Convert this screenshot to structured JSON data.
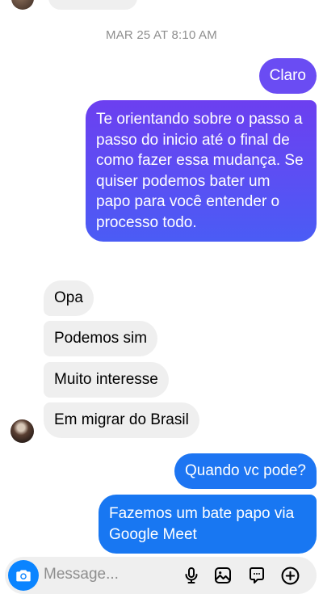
{
  "thread": {
    "date_separator": "MAR 25 AT 8:10 AM",
    "messages": [
      {
        "id": "m1",
        "direction": "outgoing",
        "text": "Claro"
      },
      {
        "id": "m2",
        "direction": "outgoing",
        "text": "Te orientando sobre o passo a passo do inicio até o final de como fazer essa mudança. Se quiser podemos bater um papo para você entender o processo todo."
      },
      {
        "id": "m3",
        "direction": "incoming",
        "text": "Opa"
      },
      {
        "id": "m4",
        "direction": "incoming",
        "text": "Podemos sim"
      },
      {
        "id": "m5",
        "direction": "incoming",
        "text": "Muito interesse"
      },
      {
        "id": "m6",
        "direction": "incoming",
        "text": "Em migrar do Brasil"
      },
      {
        "id": "m7",
        "direction": "outgoing",
        "text": "Quando vc pode?"
      },
      {
        "id": "m8",
        "direction": "outgoing",
        "text": "Fazemos um bate papo via Google Meet"
      }
    ]
  },
  "composer": {
    "placeholder": "Message...",
    "icons": [
      "camera-icon",
      "microphone-icon",
      "gallery-icon",
      "sticker-icon",
      "add-icon"
    ]
  },
  "colors": {
    "outgoing_purple": "#5b51f5",
    "outgoing_blue": "#1877f2",
    "incoming_bg": "#efefef",
    "date_text": "#8e8e8e",
    "camera_button": "#0a84ff"
  }
}
